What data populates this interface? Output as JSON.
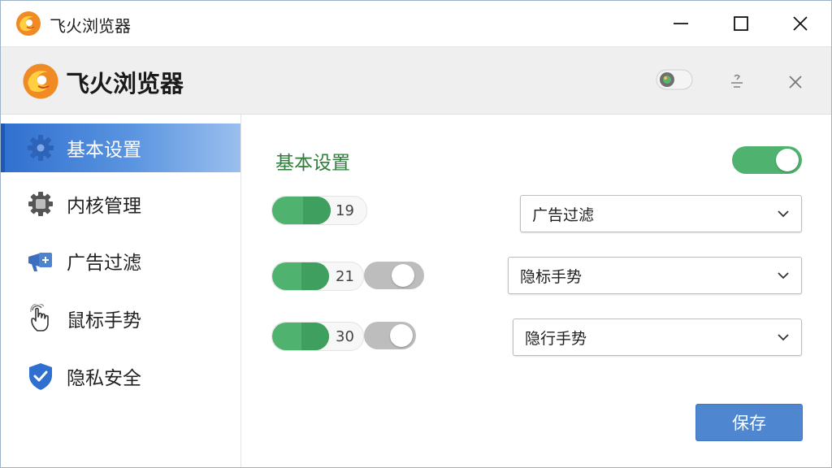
{
  "window": {
    "title": "飞火浏览器"
  },
  "header": {
    "title": "飞火浏览器"
  },
  "sidebar": {
    "items": [
      {
        "label": "基本设置",
        "icon": "gear-icon",
        "active": true
      },
      {
        "label": "内核管理",
        "icon": "chip-icon",
        "active": false
      },
      {
        "label": "广告过滤",
        "icon": "megaphone-icon",
        "active": false
      },
      {
        "label": "鼠标手势",
        "icon": "hand-pointer-icon",
        "active": false
      },
      {
        "label": "隐私安全",
        "icon": "shield-check-icon",
        "active": false
      }
    ]
  },
  "main": {
    "section_title": "基本设置",
    "master_toggle_on": true,
    "rows": [
      {
        "value": "19",
        "select_value": "广告过滤"
      },
      {
        "value": "21",
        "select_value": "隐标手势",
        "toggle_on": false
      },
      {
        "value": "30",
        "select_value": "隐行手势",
        "toggle_on": false
      }
    ],
    "save_label": "保存"
  },
  "colors": {
    "accent_blue": "#2f6fcf",
    "toggle_green": "#4fb26e",
    "section_green": "#2e7d3a",
    "button_blue": "#4e86cf"
  }
}
